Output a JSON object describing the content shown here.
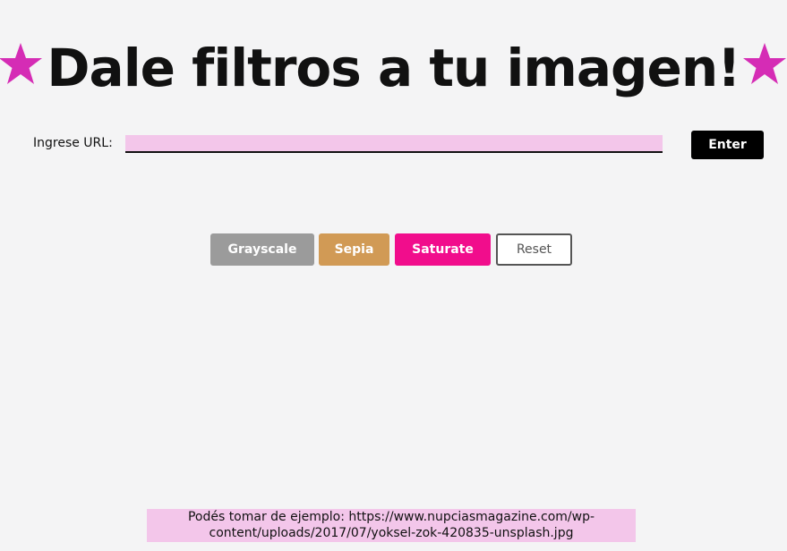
{
  "header": {
    "title": "Dale filtros a tu imagen!",
    "star_color": "#d52cb5"
  },
  "url_form": {
    "label": "Ingrese URL:",
    "input_value": "",
    "input_placeholder": "",
    "enter_label": "Enter"
  },
  "filters": {
    "grayscale_label": "Grayscale",
    "sepia_label": "Sepia",
    "saturate_label": "Saturate",
    "reset_label": "Reset",
    "colors": {
      "grayscale": "#9b9b9b",
      "sepia": "#d19a55",
      "saturate": "#f10d8c",
      "reset_border": "#555555"
    }
  },
  "footer": {
    "example_text": "Podés tomar de ejemplo: https://www.nupciasmagazine.com/wp-content/uploads/2017/07/yoksel-zok-420835-unsplash.jpg"
  },
  "icons": {
    "left": "star-icon",
    "right": "star-icon"
  }
}
